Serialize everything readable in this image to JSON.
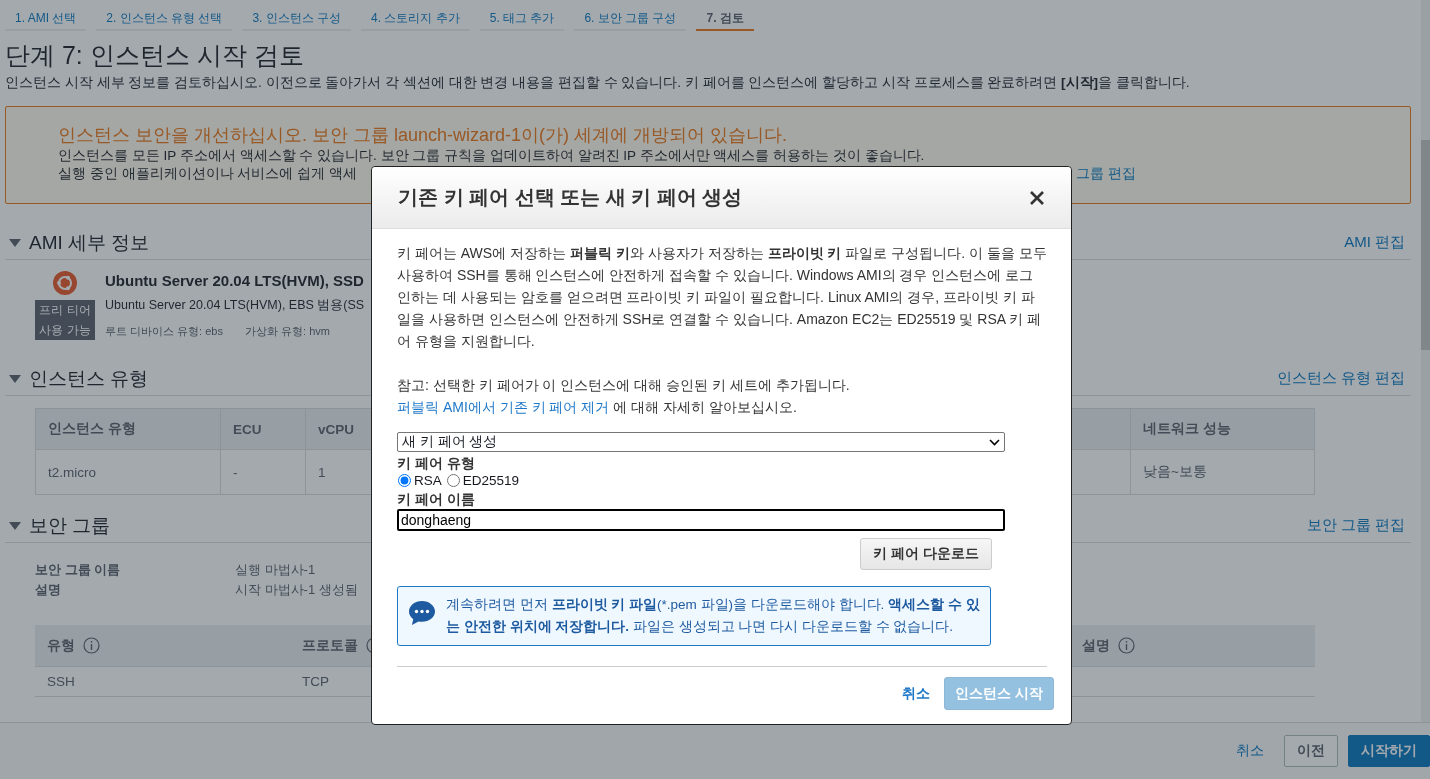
{
  "wizard_steps": [
    {
      "label": "1. AMI 선택",
      "selected": false
    },
    {
      "label": "2. 인스턴스 유형 선택",
      "selected": false
    },
    {
      "label": "3. 인스턴스 구성",
      "selected": false
    },
    {
      "label": "4. 스토리지 추가",
      "selected": false
    },
    {
      "label": "5. 태그 추가",
      "selected": false
    },
    {
      "label": "6. 보안 그룹 구성",
      "selected": false
    },
    {
      "label": "7. 검토",
      "selected": true
    }
  ],
  "page_title": "단계 7: 인스턴스 시작 검토",
  "page_description": "인스턴스 시작 세부 정보를 검토하십시오. 이전으로 돌아가서 각 섹션에 대한 변경 내용을 편집할 수 있습니다. 키 페어를 인스턴스에 할당하고 시작 프로세스를 완료하려면 **[시작]**을 클릭합니다.",
  "security_warning": {
    "title": "인스턴스 보안을 개선하십시오. 보안 그룹 launch-wizard-1이(가) 세계에 개방되어 있습니다.",
    "lines": [
      "인스턴스를 모든 IP 주소에서 액세스할 수 있습니다. 보안 그룹 규칙을 업데이트하여 알려진 IP 주소에서만 액세스를 허용하는 것이 좋습니다.",
      "실행 중인 애플리케이션이나 서비스에 쉽게 액세"
    ],
    "link": "그룹 편집"
  },
  "ami_section": {
    "title": "AMI 세부 정보",
    "expanded": true,
    "edit_link": "AMI 편집",
    "badge": "프리 티어 사용 가능",
    "name": "Ubuntu Server 20.04 LTS(HVM), SSD",
    "description": "Ubuntu Server 20.04 LTS(HVM), EBS 범용(SS",
    "root_device": "루트 디바이스 유형: ebs",
    "virtualization": "가상화 유형: hvm"
  },
  "instance_type_section": {
    "title": "인스턴스 유형",
    "expanded": true,
    "edit_link": "인스턴스 유형 편집",
    "columns": [
      "인스턴스 유형",
      "ECU",
      "vCPU",
      "네트워크 성능"
    ],
    "rows": [
      [
        "t2.micro",
        "-",
        "1",
        "낮음~보통"
      ]
    ]
  },
  "security_group_section": {
    "title": "보안 그룹",
    "expanded": true,
    "edit_link": "보안 그룹 편집",
    "details": [
      {
        "label": "보안 그룹 이름",
        "value": "실행 마법사-1"
      },
      {
        "label": "설명",
        "value": "시작 마법사-1 생성됨"
      }
    ],
    "columns": [
      "유형",
      "프로토콜",
      "설명"
    ],
    "rows": [
      [
        "SSH",
        "TCP"
      ]
    ]
  },
  "footer": {
    "cancel": "취소",
    "previous": "이전",
    "launch": "시작하기"
  },
  "modal": {
    "title": "기존 키 페어 선택 또는 새 키 페어 생성",
    "description": "키 페어는 AWS에 저장하는 **퍼블릭 키**와 사용자가 저장하는 **프라이빗 키** 파일로 구성됩니다. 이 둘을 모두 사용하여 SSH를 통해 인스턴스에 안전하게 접속할 수 있습니다. Windows AMI의 경우 인스턴스에 로그인하는 데 사용되는 암호를 얻으려면 프라이빗 키 파일이 필요합니다. Linux AMI의 경우, 프라이빗 키 파일을 사용하면 인스턴스에 안전하게 SSH로 연결할 수 있습니다. Amazon EC2는 ED25519 및 RSA 키 페어 유형을 지원합니다.",
    "note": "참고: 선택한 키 페어가 이 인스턴스에 대해 승인된 키 세트에 추가됩니다.",
    "note_link": "퍼블릭 AMI에서 기존 키 페어 제거",
    "note_suffix": "에 대해 자세히 알아보십시오.",
    "key_pair_select": "새 키 페어 생성",
    "key_pair_type": {
      "label": "키 페어 유형",
      "options": [
        {
          "label": "RSA",
          "selected": true
        },
        {
          "label": "ED25519",
          "selected": false
        }
      ]
    },
    "key_pair_name": {
      "label": "키 페어 이름",
      "value": "donghaeng"
    },
    "download_button": "키 페어 다운로드",
    "info": "계속하려면 먼저 **프라이빗 키 파일**(*.pem 파일)을 다운로드해야 합니다. **액세스할 수 있는 안전한 위치에 저장합니다.** 파일은 생성되고 나면 다시 다운로드할 수 없습니다.",
    "cancel": "취소",
    "launch": {
      "label": "인스턴스 시작",
      "disabled": true
    }
  }
}
